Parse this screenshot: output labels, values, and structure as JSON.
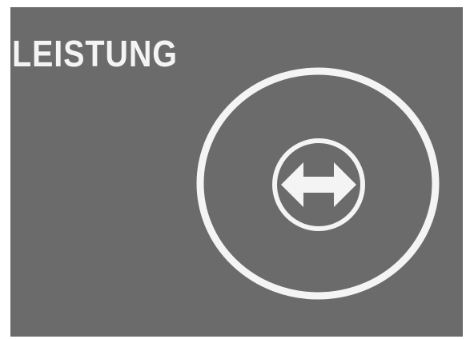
{
  "screen": {
    "title": "LEISTUNG",
    "colors": {
      "background": "#6b6b6b",
      "foreground": "#f4f4f4",
      "frame": "#ffffff"
    }
  },
  "control": {
    "outer_ring_icon": "circle-ring-icon",
    "center_icon": "left-right-arrow-icon"
  }
}
